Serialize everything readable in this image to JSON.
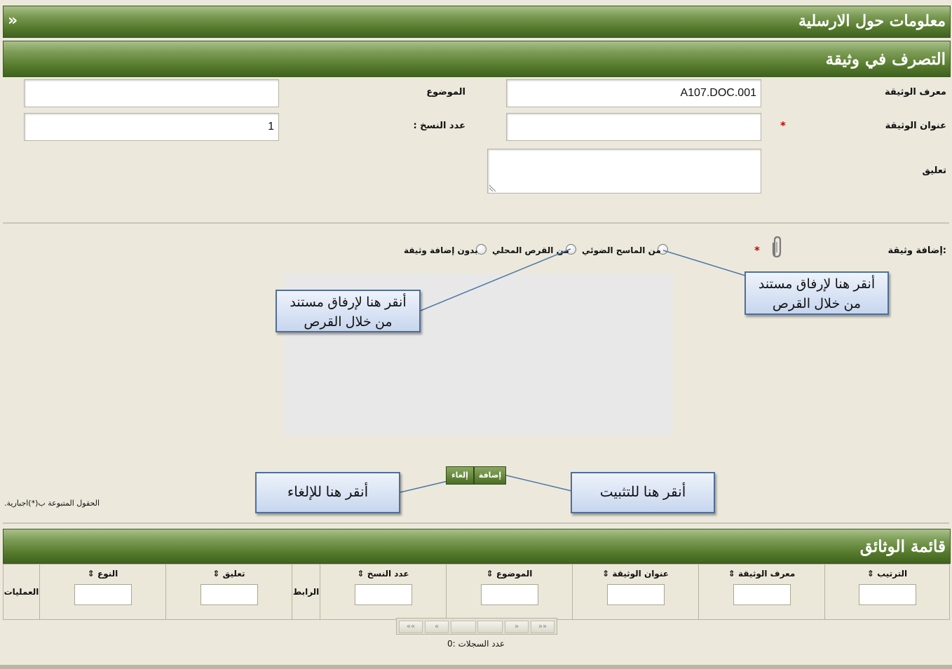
{
  "header": {
    "title": "معلومات حول الارسلية",
    "collapse_glyph": "»"
  },
  "section": {
    "title": "التصرف في وثيقة"
  },
  "form": {
    "doc_id_label": "معرف الوثيقة",
    "doc_id_value": "A107.DOC.001",
    "subject_label": "الموضوع",
    "subject_value": "",
    "doc_title_label": "عنوان الوثيقة",
    "doc_title_value": "",
    "copies_label": "عدد النسخ :",
    "copies_value": "1",
    "comment_label": "تعليق",
    "comment_value": "",
    "required_mark": "*"
  },
  "attach": {
    "label": ":إضافة وثيقة",
    "options": [
      "من الماسح الضوئي",
      "من القرص المحلي",
      "بدون إضافة وثيقة"
    ],
    "attach_icon": "paperclip-icon"
  },
  "buttons": {
    "add": "إضافة",
    "cancel": "إلغاء"
  },
  "required_note": "الحقول المتبوعة ب(*)اجبارية.",
  "callouts": {
    "scanner": "أنقر  هنا لإرفاق مستند من خلال القرص",
    "local": "أنقر  هنا لإرفاق مستند من خلال القرص",
    "confirm": "أنقر  هنا للتثبيت",
    "cancel": "أنقر  هنا للإلغاء"
  },
  "documents": {
    "title": "قائمة الوثائق",
    "columns": [
      "الترتيب",
      "معرف الوثيقة",
      "عنوان الوثيقة",
      "الموضوع",
      "عدد النسخ",
      "الرابط",
      "تعليق",
      "النوع",
      "العمليات"
    ],
    "sort_glyph": "⇕",
    "pager": {
      "first": "««",
      "prev": "«",
      "next": "»",
      "last": "»»"
    },
    "record_count_text": "عدد السجلات :0"
  },
  "colors": {
    "bar_green": "#557a2c",
    "callout_border": "#4f6f9a",
    "required_red": "#cc0000"
  }
}
